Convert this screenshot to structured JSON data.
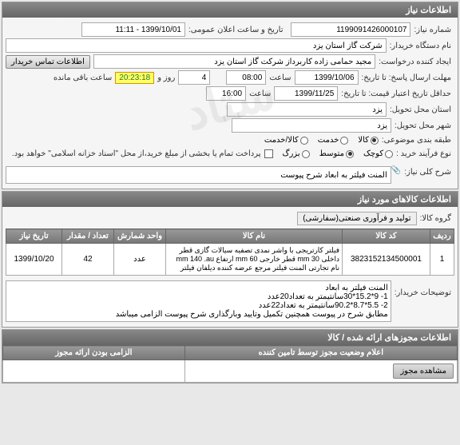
{
  "panels": {
    "info": {
      "title": "اطلاعات نیاز",
      "need_no_label": "شماره نیاز:",
      "need_no": "1199091426000107",
      "announce_label": "تاریخ و ساعت اعلان عمومی:",
      "announce_value": "1399/10/01 - 11:11",
      "buyer_label": "نام دستگاه خریدار:",
      "buyer_value": "شرکت گاز استان یزد",
      "creator_label": "ایجاد کننده درخواست:",
      "creator_value": "مجید حمامی زاده کاربرداز شرکت گاز استان یزد",
      "contact_btn": "اطلاعات تماس خریدار",
      "reply_deadline_label": "مهلت ارسال پاسخ: تا تاریخ:",
      "reply_date": "1399/10/06",
      "time_label": "ساعت",
      "reply_time": "08:00",
      "days_remaining": "4",
      "days_label": "روز و",
      "countdown": "20:23:18",
      "remaining_label": "ساعت باقی مانده",
      "price_deadline_label": "حداقل تاریخ اعتبار قیمت: تا تاریخ:",
      "price_date": "1399/11/25",
      "price_time": "16:00",
      "delivery_province_label": "استان محل تحویل:",
      "delivery_province": "یزد",
      "delivery_city_label": "شهر محل تحویل:",
      "delivery_city": "یزد",
      "budget_label": "طبقه بندی موضوعی:",
      "budget_options": {
        "goods": "کالا",
        "service": "خدمت",
        "both": "کالا/خدمت"
      },
      "purchase_type_label": "نوع فرآیند خرید :",
      "purchase_options": {
        "small": "کوچک",
        "medium": "متوسط",
        "large": "بزرگ"
      },
      "payment_note_label": "پرداخت تمام یا بخشی از مبلغ خرید،از محل \"اسناد خزانه اسلامی\" خواهد بود.",
      "general_desc_label": "شرح کلی نیاز:",
      "general_desc_value": "المنت فیلتر به ابعاد شرح پیوست",
      "attach_icon": "📎"
    },
    "goods": {
      "title": "اطلاعات کالاهای مورد نیاز",
      "group_label": "گروه کالا:",
      "group_value": "تولید و فرآوری صنعتی(سفارشی)",
      "table": {
        "headers": [
          "ردیف",
          "کد کالا",
          "نام کالا",
          "واحد شمارش",
          "تعداد / مقدار",
          "تاریخ نیاز"
        ],
        "rows": [
          {
            "idx": "1",
            "code": "3823152134500001",
            "name": "فیلتر کارتریجی با واشر نمدی تصفیه سیالات گازی قطر داخلی mm 30 قطر خارجی mm 60 ارتفاع mm 140 .au نام تجارتی المنت فیلتر مرجع عرضه کننده دیلفان فیلتر",
            "unit": "عدد",
            "qty": "42",
            "date": "1399/10/20"
          }
        ]
      },
      "buyer_notes_label": "توضیحات خریدار:",
      "buyer_notes_value": "المنت فیلتر به ابعاد\n1-   9*15.2*30سانتیمتر به تعداد20عدد\n2-   5.5*8.7*90.2سانتیمتر به تعداد22عدد\nمطابق شرح در پیوست همچنین تکمیل وتایید وبارگذاری شرح پیوست الزامی میباشد"
    },
    "docs": {
      "title": "اطلاعات مجوزهای ارائه شده / کالا",
      "confirm_title": "اعلام وضعیت مجوز توسط تامین کننده",
      "required_title": "الزامی بودن ارائه مجوز",
      "view_btn": "مشاهده مجوز"
    }
  }
}
